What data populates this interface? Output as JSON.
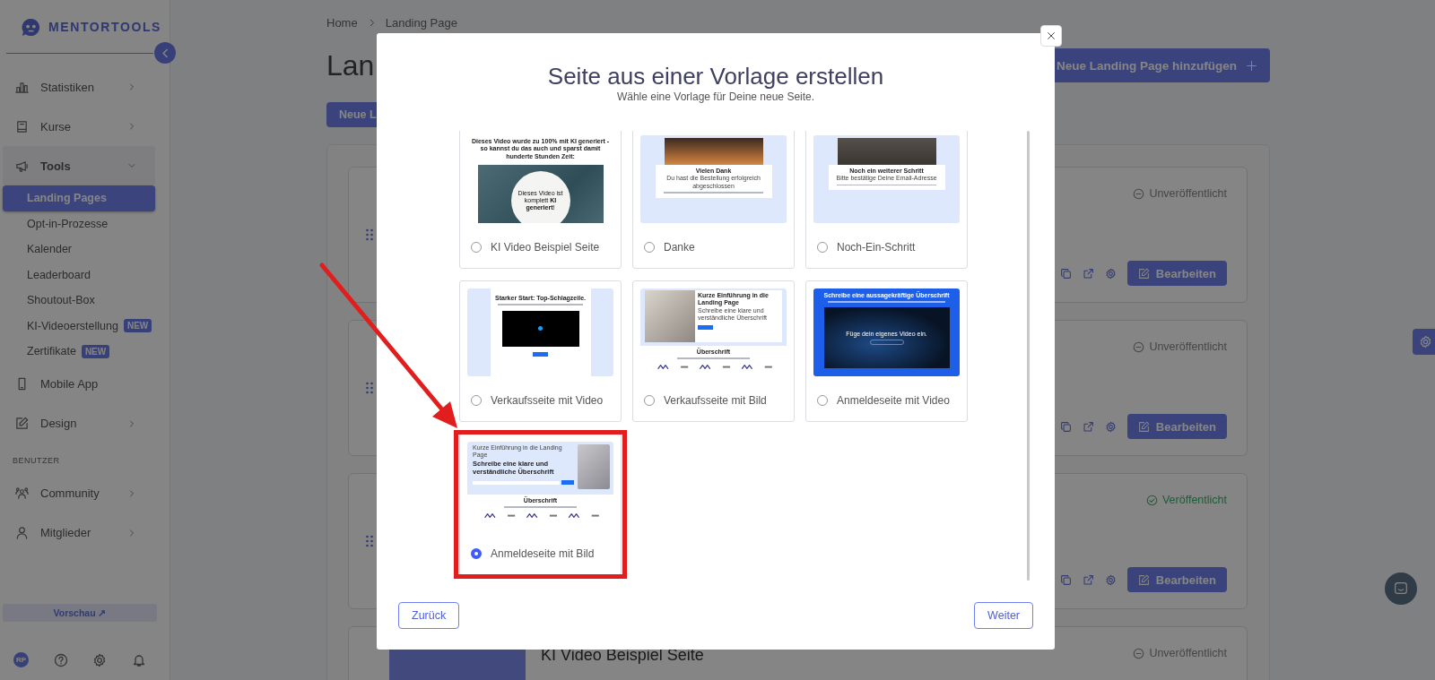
{
  "sidebar": {
    "logo": "MENTORTOOLS",
    "items": [
      {
        "kind": "item",
        "label": "Statistiken",
        "expanded": false
      },
      {
        "kind": "item",
        "label": "Kurse",
        "expanded": false
      },
      {
        "kind": "item",
        "label": "Tools",
        "expanded": true
      },
      {
        "kind": "subitem",
        "label": "Landing Pages",
        "selected": true
      },
      {
        "kind": "subitem",
        "label": "Opt-in-Prozesse",
        "selected": false
      },
      {
        "kind": "subitem",
        "label": "Kalender",
        "selected": false
      },
      {
        "kind": "subitem",
        "label": "Leaderboard",
        "selected": false
      },
      {
        "kind": "subitem",
        "label": "Shoutout-Box",
        "selected": false
      },
      {
        "kind": "subitem",
        "label": "KI-Videoerstellung",
        "selected": false,
        "badge": "NEW"
      },
      {
        "kind": "subitem",
        "label": "Zertifikate",
        "selected": false,
        "badge": "NEW"
      },
      {
        "kind": "item",
        "label": "Mobile App"
      },
      {
        "kind": "item",
        "label": "Design",
        "expanded": false
      },
      {
        "kind": "section",
        "label": "BENUTZER"
      },
      {
        "kind": "item",
        "label": "Community",
        "expanded": false
      },
      {
        "kind": "item",
        "label": "Mitglieder",
        "expanded": false
      }
    ],
    "preview_button": "Vorschau ↗",
    "avatar": "RP"
  },
  "main": {
    "breadcrumb": [
      "Home",
      "Landing Page"
    ],
    "title": "Lan",
    "add_button": "Neue Landing Page hinzufügen",
    "secondary_button": "Neue L",
    "cards": [
      {
        "status": "Unveröffentlicht",
        "published": false,
        "edit_label": "Bearbeiten"
      },
      {
        "status": "Unveröffentlicht",
        "published": false,
        "edit_label": "Bearbeiten"
      },
      {
        "status": "Veröffentlicht",
        "published": true,
        "edit_label": "Bearbeiten"
      },
      {
        "status": "Unveröffentlicht",
        "published": false,
        "title": "KI Video Beispiel Seite"
      }
    ]
  },
  "modal": {
    "title": "Seite aus einer Vorlage erstellen",
    "subtitle": "Wähle eine Vorlage für Deine neue Seite.",
    "templates": [
      {
        "name": "KI Video Beispiel Seite",
        "selected": false,
        "highlighted": false,
        "preview": {
          "kind": "ki_video",
          "heading": "Dieses Video wurde zu 100% mit KI generiert - so kannst du das auch und sparst damit hunderte Stunden Zeit:",
          "circle_text": "Dieses Video ist komplett **KI generiert**!"
        }
      },
      {
        "name": "Danke",
        "selected": false,
        "highlighted": false,
        "preview": {
          "kind": "thank_you",
          "heading": "Vielen Dank",
          "subheading": "Du hast die Bestellung erfolgreich abgeschlossen"
        }
      },
      {
        "name": "Noch-Ein-Schritt",
        "selected": false,
        "highlighted": false,
        "preview": {
          "kind": "thank_you",
          "heading": "Noch ein weiterer Schritt",
          "subheading": "Bitte bestätige Deine Email-Adresse"
        }
      },
      {
        "name": "Verkaufsseite mit Video",
        "selected": false,
        "highlighted": false,
        "preview": {
          "kind": "sales_video",
          "heading": "Starker Start: Top-Schlagzeile."
        }
      },
      {
        "name": "Verkaufsseite mit Bild",
        "selected": false,
        "highlighted": false,
        "preview": {
          "kind": "sales_image",
          "heading": "Kurze Einführung in die Landing Page",
          "subheading": "Schreibe eine klare und verständliche Überschrift",
          "section_heading": "Überschrift"
        }
      },
      {
        "name": "Anmeldeseite mit Video",
        "selected": false,
        "highlighted": false,
        "preview": {
          "kind": "signup_video",
          "heading": "Schreibe eine aussagekräftige Überschrift",
          "video_text": "Füge dein eigenes Video ein."
        }
      },
      {
        "name": "Anmeldeseite mit Bild",
        "selected": true,
        "highlighted": true,
        "preview": {
          "kind": "signup_image",
          "eyebrow": "Kurze Einführung in die Landing Page",
          "heading": "Schreibe eine klare und verständliche Überschrift",
          "section_heading": "Überschrift"
        }
      }
    ],
    "back_button": "Zurück",
    "next_button": "Weiter"
  }
}
